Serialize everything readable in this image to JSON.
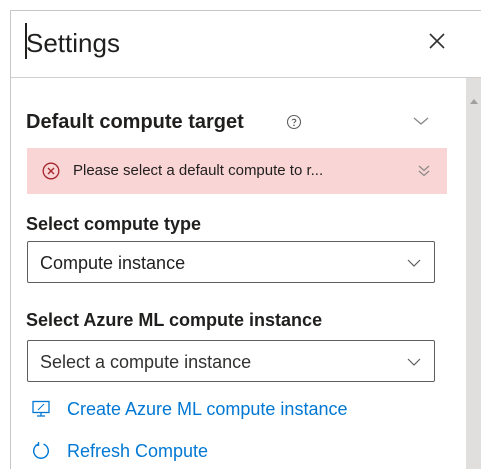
{
  "panel": {
    "title": "Settings",
    "close_icon": "close-icon"
  },
  "default_compute": {
    "heading": "Default compute target",
    "help_icon": "help-circle-icon",
    "collapse_icon": "chevron-up-icon"
  },
  "error_banner": {
    "icon": "error-circle-icon",
    "message": "Please select a default compute to r...",
    "expand_icon": "double-chevron-down-icon",
    "background": "#f9d5d5",
    "icon_color": "#a4262c"
  },
  "compute_type": {
    "label": "Select compute type",
    "selected": "Compute instance"
  },
  "compute_instance": {
    "label": "Select Azure ML compute instance",
    "placeholder": "Select a compute instance"
  },
  "links": {
    "create_label": "Create Azure ML compute instance",
    "create_icon": "monitor-icon",
    "refresh_label": "Refresh Compute",
    "refresh_icon": "refresh-icon",
    "color": "#0078d4"
  }
}
